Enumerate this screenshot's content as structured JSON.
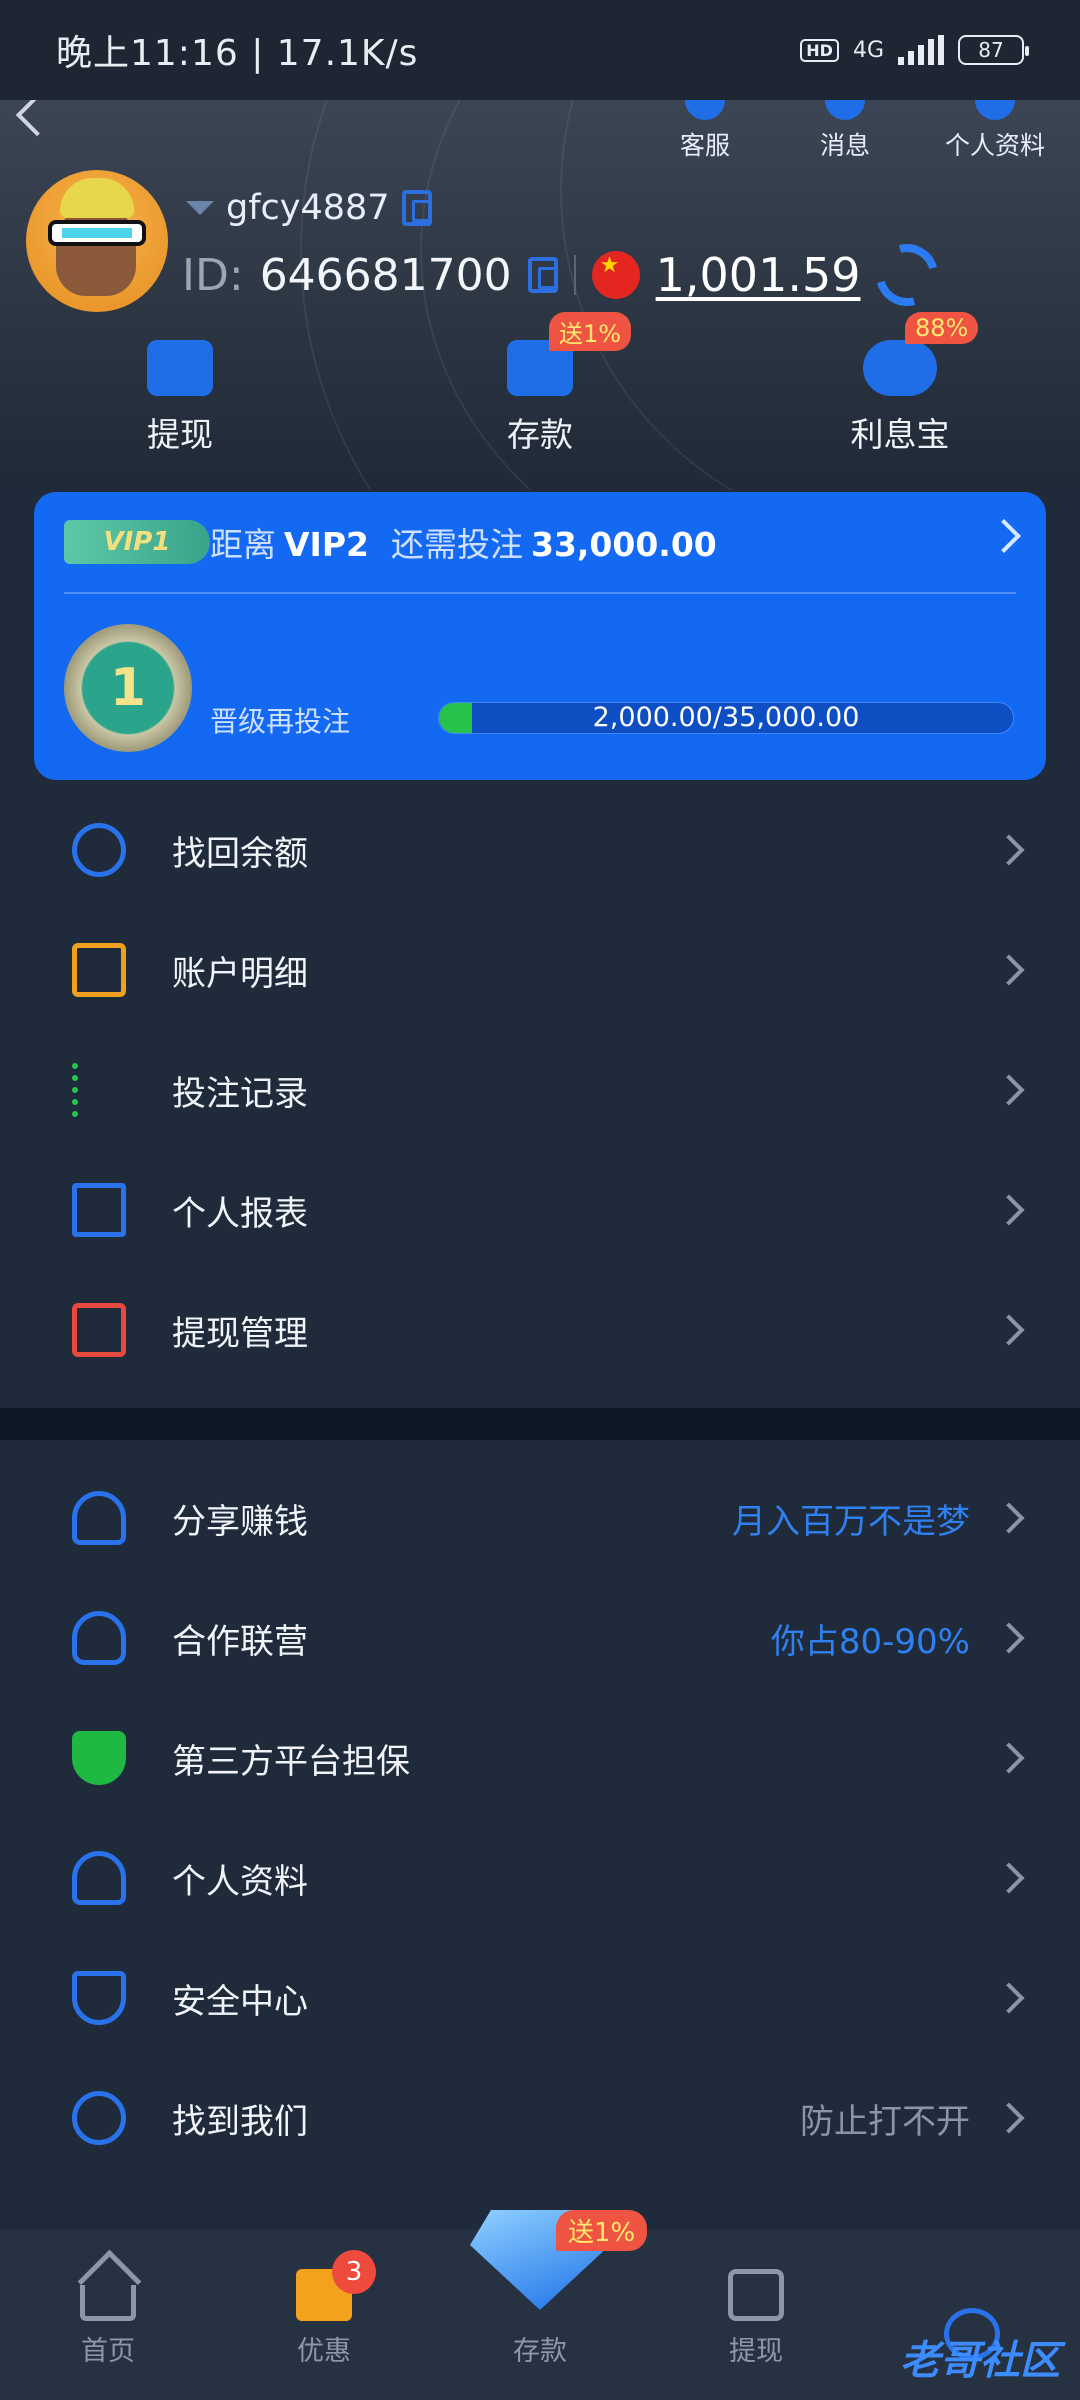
{
  "status_bar": {
    "time": "晚上11:16 | 17.1K/s",
    "hd": "HD",
    "network": "4G",
    "battery": "87"
  },
  "header": {
    "tools": [
      {
        "label": "客服",
        "icon": "headset-icon"
      },
      {
        "label": "消息",
        "icon": "message-icon"
      },
      {
        "label": "个人资料",
        "icon": "profile-icon"
      }
    ],
    "username": "gfcy4887",
    "id_label": "ID:",
    "id_value": "646681700",
    "balance": "1,001.59",
    "quick_actions": [
      {
        "label": "提现",
        "icon": "withdraw-icon",
        "badge": ""
      },
      {
        "label": "存款",
        "icon": "wallet-icon",
        "badge": "送1%"
      },
      {
        "label": "利息宝",
        "icon": "piggy-bank-icon",
        "badge": "88%"
      }
    ]
  },
  "vip": {
    "level_badge": "VIP1",
    "distance_prefix": "距离",
    "next_level": "VIP2",
    "need_label": "还需投注",
    "need_amount": "33,000.00",
    "medal_number": "1",
    "upgrade_label": "晋级再投注",
    "progress_text": "2,000.00/35,000.00",
    "progress_fraction": 0.057
  },
  "menu_group_1": [
    {
      "label": "找回余额",
      "icon": "coin-search-icon",
      "note": ""
    },
    {
      "label": "账户明细",
      "icon": "account-detail-icon",
      "note": ""
    },
    {
      "label": "投注记录",
      "icon": "bet-record-icon",
      "note": ""
    },
    {
      "label": "个人报表",
      "icon": "report-search-icon",
      "note": ""
    },
    {
      "label": "提现管理",
      "icon": "withdraw-manage-icon",
      "note": ""
    }
  ],
  "menu_group_2": [
    {
      "label": "分享赚钱",
      "icon": "share-user-icon",
      "note": "月入百万不是梦"
    },
    {
      "label": "合作联营",
      "icon": "club-icon",
      "note": "你占80-90%"
    },
    {
      "label": "第三方平台担保",
      "icon": "shield-check-icon",
      "note": ""
    },
    {
      "label": "个人资料",
      "icon": "user-edit-icon",
      "note": ""
    },
    {
      "label": "安全中心",
      "icon": "security-shield-icon",
      "note": ""
    },
    {
      "label": "找到我们",
      "icon": "find-us-icon",
      "note": "防止打不开"
    }
  ],
  "bottom_nav": [
    {
      "label": "首页",
      "icon": "home-icon",
      "badge": ""
    },
    {
      "label": "优惠",
      "icon": "gift-icon",
      "badge": "3"
    },
    {
      "label": "存款",
      "icon": "diamond-deposit-icon",
      "badge": "送1%"
    },
    {
      "label": "提现",
      "icon": "withdraw-ticket-icon",
      "badge": ""
    },
    {
      "label": "",
      "icon": "agent-icon",
      "badge": ""
    }
  ],
  "watermark": "老哥社区"
}
